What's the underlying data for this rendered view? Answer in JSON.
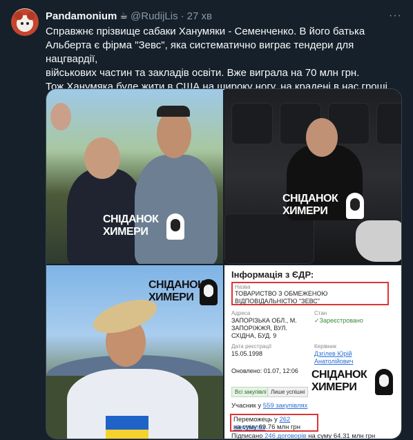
{
  "tweet": {
    "author_name": "Pandamonium",
    "author_emoji": "☕",
    "handle": "@RudijLis",
    "separator": "·",
    "time": "27 хв",
    "more": "···",
    "text_lines": [
      "Справжнє прізвище сабаки Ханумяки - Семенченко. В його батька",
      "Альберта є фірма \"Зевс\", яка систематично виграє тендери для нацгвардії,",
      "військових частин та закладів освіти. Вже виграла на 70 млн грн.",
      "Тож Ханумяка буде жити в США на широку ногу, на крадені в нас гроші"
    ]
  },
  "brand": {
    "line1": "СНІДАНОК",
    "line2": "ХИМЕРИ"
  },
  "edr": {
    "title": "Інформація з ЄДР:",
    "name_label": "Назва",
    "name_value": "ТОВАРИСТВО З ОБМЕЖЕНОЮ ВІДПОВІДАЛЬНІСТЮ \"ЗЕВС\"",
    "address_label": "Адреса",
    "address_lines": [
      "ЗАПОРІЗЬКА ОБЛ., М.",
      "ЗАПОРІЖЖЯ, ВУЛ.",
      "СХІДНА, БУД. 9"
    ],
    "status_label": "Стан",
    "status_value": "✓Зареєстровано",
    "reg_label": "Дата реєстрації",
    "reg_value": "15.05.1998",
    "head_label": "Керівник",
    "head_lines": [
      "Дзгілев Юрій",
      "Анатолійович"
    ],
    "updated": "Оновлено: 01.07, 12:06",
    "tag_all": "Всі закупівлі",
    "tag_won": "Лише успішні",
    "participant_prefix": "Учасник у ",
    "participant_link": "559 закупівлях",
    "winner_prefix": "Переможець у ",
    "winner_link": "262 закупівлях",
    "winner_sum": "на суму 69.76 млн грн",
    "signed_prefix": "Підписано ",
    "signed_link": "246 договорів",
    "signed_sum": " на суму 64.31 млн грн"
  }
}
